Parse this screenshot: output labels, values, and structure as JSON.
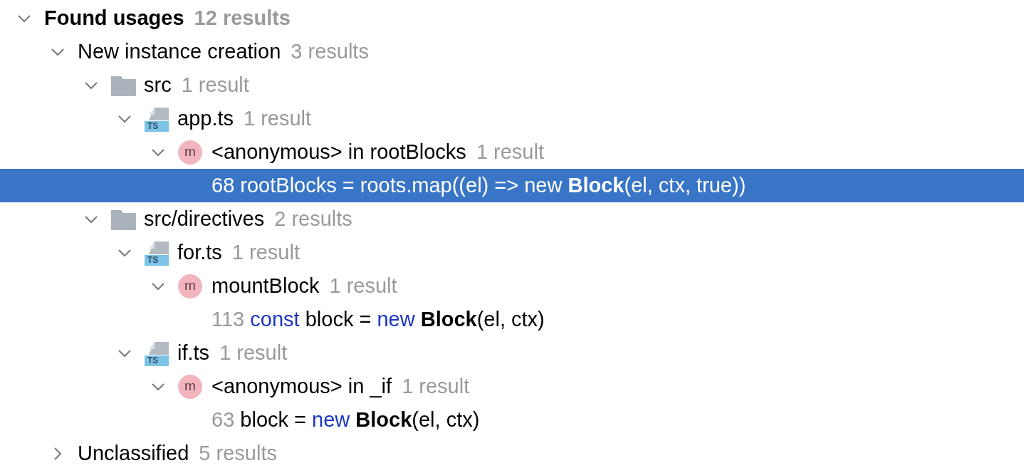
{
  "tree": [
    {
      "kind": "root",
      "label": "Found usages",
      "count": "12 results",
      "expanded": true,
      "selected": false,
      "children": [
        {
          "kind": "group",
          "label": "New instance creation",
          "count": "3 results",
          "expanded": true,
          "selected": false,
          "children": [
            {
              "kind": "folder",
              "label": "src",
              "count": "1 result",
              "expanded": true,
              "selected": false,
              "children": [
                {
                  "kind": "file",
                  "badge": "TS",
                  "label": "app.ts",
                  "count": "1 result",
                  "expanded": true,
                  "selected": false,
                  "children": [
                    {
                      "kind": "method",
                      "badge": "m",
                      "label": "<anonymous> in rootBlocks",
                      "count": "1 result",
                      "expanded": true,
                      "selected": false,
                      "children": [
                        {
                          "kind": "line",
                          "number": "68",
                          "selected": true,
                          "segments": [
                            {
                              "kind": "plain",
                              "text": "rootBlocks = roots.map((el) => new "
                            },
                            {
                              "kind": "bold",
                              "text": "Block"
                            },
                            {
                              "kind": "plain",
                              "text": "(el, ctx, true))"
                            }
                          ]
                        }
                      ]
                    }
                  ]
                }
              ]
            },
            {
              "kind": "folder",
              "label": "src/directives",
              "count": "2 results",
              "expanded": true,
              "selected": false,
              "children": [
                {
                  "kind": "file",
                  "badge": "TS",
                  "label": "for.ts",
                  "count": "1 result",
                  "expanded": true,
                  "selected": false,
                  "children": [
                    {
                      "kind": "method",
                      "badge": "m",
                      "label": "mountBlock",
                      "count": "1 result",
                      "expanded": true,
                      "selected": false,
                      "children": [
                        {
                          "kind": "line",
                          "number": "113",
                          "selected": false,
                          "segments": [
                            {
                              "kind": "keyword",
                              "text": "const"
                            },
                            {
                              "kind": "plain",
                              "text": " block = "
                            },
                            {
                              "kind": "keyword",
                              "text": "new "
                            },
                            {
                              "kind": "bold",
                              "text": "Block"
                            },
                            {
                              "kind": "plain",
                              "text": "(el, ctx)"
                            }
                          ]
                        }
                      ]
                    }
                  ]
                },
                {
                  "kind": "file",
                  "badge": "TS",
                  "label": "if.ts",
                  "count": "1 result",
                  "expanded": true,
                  "selected": false,
                  "children": [
                    {
                      "kind": "method",
                      "badge": "m",
                      "label": "<anonymous> in _if",
                      "count": "1 result",
                      "expanded": true,
                      "selected": false,
                      "children": [
                        {
                          "kind": "line",
                          "number": "63",
                          "selected": false,
                          "segments": [
                            {
                              "kind": "plain",
                              "text": "block = "
                            },
                            {
                              "kind": "keyword",
                              "text": "new "
                            },
                            {
                              "kind": "bold",
                              "text": "Block"
                            },
                            {
                              "kind": "plain",
                              "text": "(el, ctx)"
                            }
                          ]
                        }
                      ]
                    }
                  ]
                }
              ]
            }
          ]
        },
        {
          "kind": "group",
          "label": "Unclassified",
          "count": "5 results",
          "expanded": false,
          "selected": false
        }
      ]
    }
  ]
}
